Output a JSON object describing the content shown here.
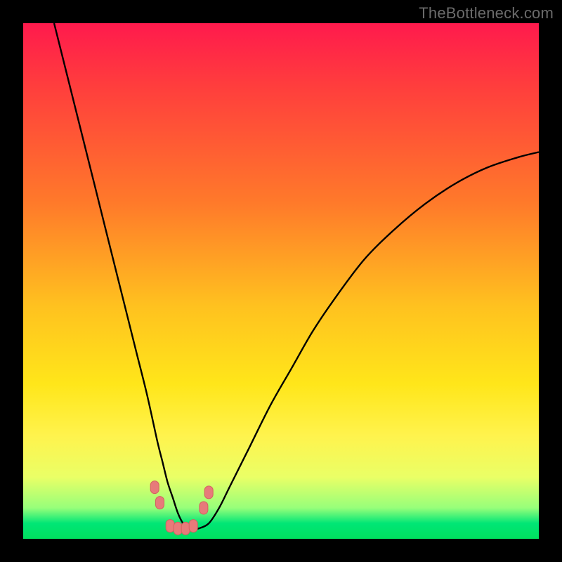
{
  "watermark": "TheBottleneck.com",
  "colors": {
    "frame": "#000000",
    "watermark": "#6b6b6b",
    "curve": "#000000",
    "marker_fill": "#e77a7a",
    "marker_stroke": "#d46060"
  },
  "chart_data": {
    "type": "line",
    "title": "",
    "xlabel": "",
    "ylabel": "",
    "xlim": [
      0,
      100
    ],
    "ylim": [
      0,
      100
    ],
    "grid": false,
    "series": [
      {
        "name": "curve",
        "x": [
          6,
          8,
          10,
          12,
          14,
          16,
          18,
          20,
          22,
          24,
          26,
          27,
          28,
          29,
          30,
          31,
          32,
          33,
          34,
          36,
          38,
          40,
          44,
          48,
          52,
          56,
          60,
          66,
          72,
          78,
          84,
          90,
          96,
          100
        ],
        "y": [
          100,
          92,
          84,
          76,
          68,
          60,
          52,
          44,
          36,
          28,
          19,
          15,
          11,
          8,
          5,
          3,
          2,
          2,
          2,
          3,
          6,
          10,
          18,
          26,
          33,
          40,
          46,
          54,
          60,
          65,
          69,
          72,
          74,
          75
        ]
      }
    ],
    "markers": [
      {
        "x": 25.5,
        "y": 10
      },
      {
        "x": 26.5,
        "y": 7
      },
      {
        "x": 28.5,
        "y": 2.5
      },
      {
        "x": 30.0,
        "y": 2
      },
      {
        "x": 31.5,
        "y": 2
      },
      {
        "x": 33.0,
        "y": 2.5
      },
      {
        "x": 35.0,
        "y": 6
      },
      {
        "x": 36.0,
        "y": 9
      }
    ]
  }
}
